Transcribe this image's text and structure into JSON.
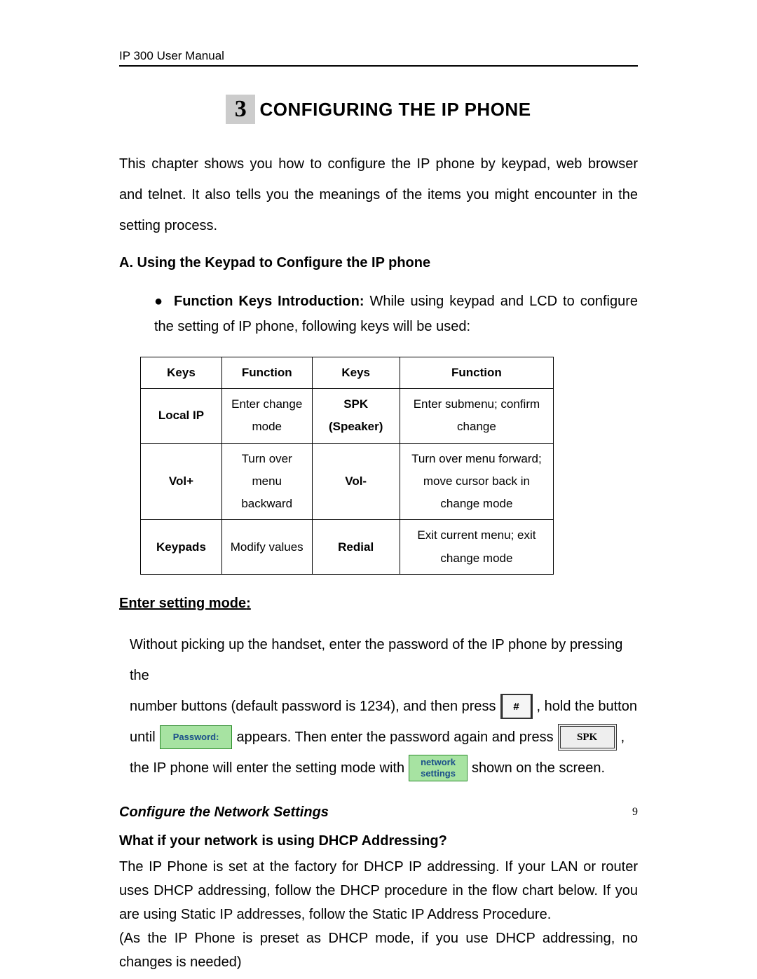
{
  "header": "IP 300 User Manual",
  "chapter": {
    "num": "3",
    "title": "CONFIGURING THE IP PHONE"
  },
  "intro": "This chapter shows you how to configure the IP phone by keypad, web browser and telnet. It also tells you the meanings of the items you might encounter in the setting process.",
  "sectionA": "A. Using the Keypad to Configure the IP phone",
  "bulletLead": "Function Keys Introduction:",
  "bulletBody": " While using keypad and LCD to configure the setting of IP phone, following keys will be used:",
  "table": {
    "headers": [
      "Keys",
      "Function",
      "Keys",
      "Function"
    ],
    "rows": [
      {
        "k1": "Local IP",
        "f1": "Enter change mode",
        "k2": "SPK (Speaker)",
        "f2": "Enter submenu; confirm change"
      },
      {
        "k1": "Vol+",
        "f1": "Turn over menu backward",
        "k2": "Vol-",
        "f2": "Turn over menu forward; move cursor back in change mode"
      },
      {
        "k1": "Keypads",
        "f1": "Modify values",
        "k2": "Redial",
        "f2": "Exit current menu; exit change mode"
      }
    ]
  },
  "settingModeHeading": "Enter setting mode",
  "flow": {
    "t1": "Without picking up the handset, enter the password of the IP phone by pressing the",
    "t2": "number buttons (default password is 1234), and then press",
    "hashKey": "#",
    "t3": ", hold the button",
    "t4": "until",
    "passwordBox": "Password:",
    "t5": "appears. Then enter the password again and press",
    "spkKey": "SPK",
    "t6": ",",
    "t7": "the IP phone will enter the setting mode with",
    "netBox1": "network",
    "netBox2": "settings",
    "t8": "shown on the screen."
  },
  "configHeading": "Configure the Network Settings",
  "dhcpHeading": "What if your network is using DHCP Addressing?",
  "p1": "The IP Phone is set at the factory for DHCP IP addressing. If your LAN or router uses DHCP addressing, follow the DHCP procedure in the flow chart below. If you are using Static IP addresses, follow the Static IP Address Procedure.",
  "p2": "(As the IP Phone is preset as DHCP mode, if you use DHCP addressing, no changes is needed)",
  "pageNumber": "9"
}
